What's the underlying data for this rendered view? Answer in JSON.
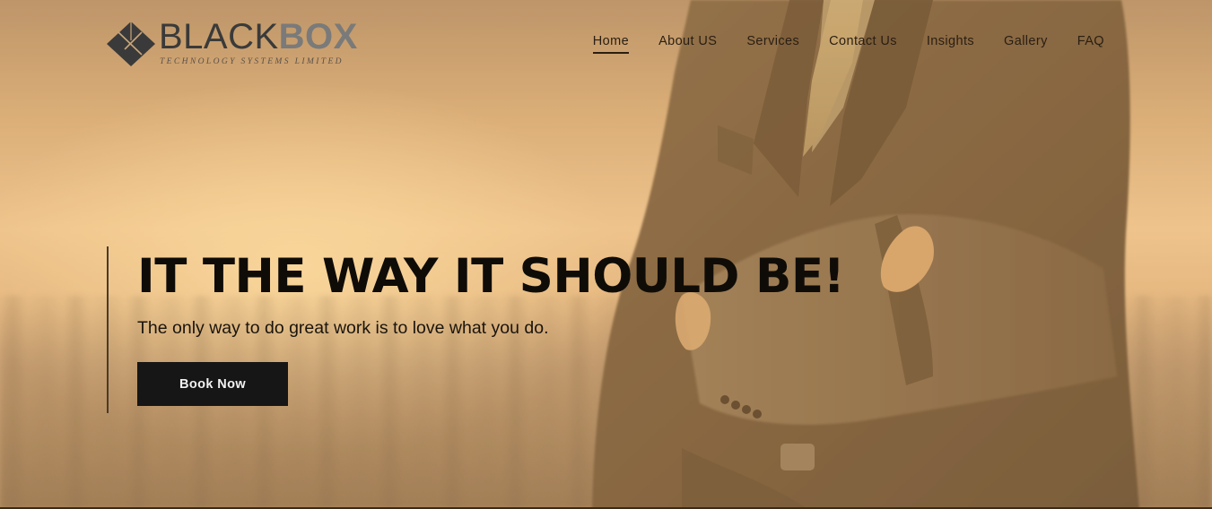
{
  "brand": {
    "word_dark": "BLACK",
    "word_light": "BOX",
    "subtitle": "TECHNOLOGY SYSTEMS LIMITED"
  },
  "nav": {
    "items": [
      {
        "label": "Home",
        "active": true
      },
      {
        "label": "About US",
        "active": false
      },
      {
        "label": "Services",
        "active": false
      },
      {
        "label": "Contact Us",
        "active": false
      },
      {
        "label": "Insights",
        "active": false
      },
      {
        "label": "Gallery",
        "active": false
      },
      {
        "label": "FAQ",
        "active": false
      }
    ]
  },
  "hero": {
    "headline": "IT THE WAY IT SHOULD BE!",
    "tagline": "The only way to do great work is to love what you do.",
    "cta_label": "Book Now"
  },
  "colors": {
    "accent_dark": "#161616",
    "background_tint": "#e6b983"
  }
}
